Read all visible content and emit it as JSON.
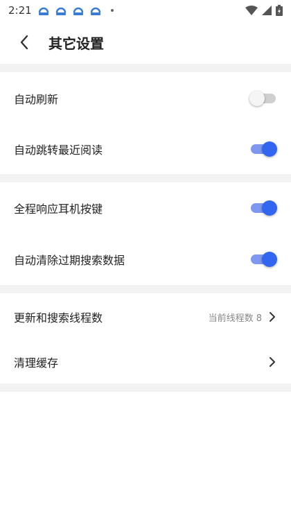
{
  "status": {
    "time": "2:21"
  },
  "header": {
    "title": "其它设置"
  },
  "sections": [
    [
      {
        "label": "自动刷新",
        "on": false
      },
      {
        "label": "自动跳转最近阅读",
        "on": true
      }
    ],
    [
      {
        "label": "全程响应耳机按键",
        "on": true
      },
      {
        "label": "自动清除过期搜索数据",
        "on": true
      }
    ],
    [
      {
        "label": "更新和搜索线程数",
        "value": "当前线程数 8"
      },
      {
        "label": "清理缓存"
      }
    ]
  ],
  "colors": {
    "accent": "#3366f0",
    "accent_track": "#7e97ef",
    "off_track": "#cfcfcf",
    "divider": "#f2f2f2"
  }
}
